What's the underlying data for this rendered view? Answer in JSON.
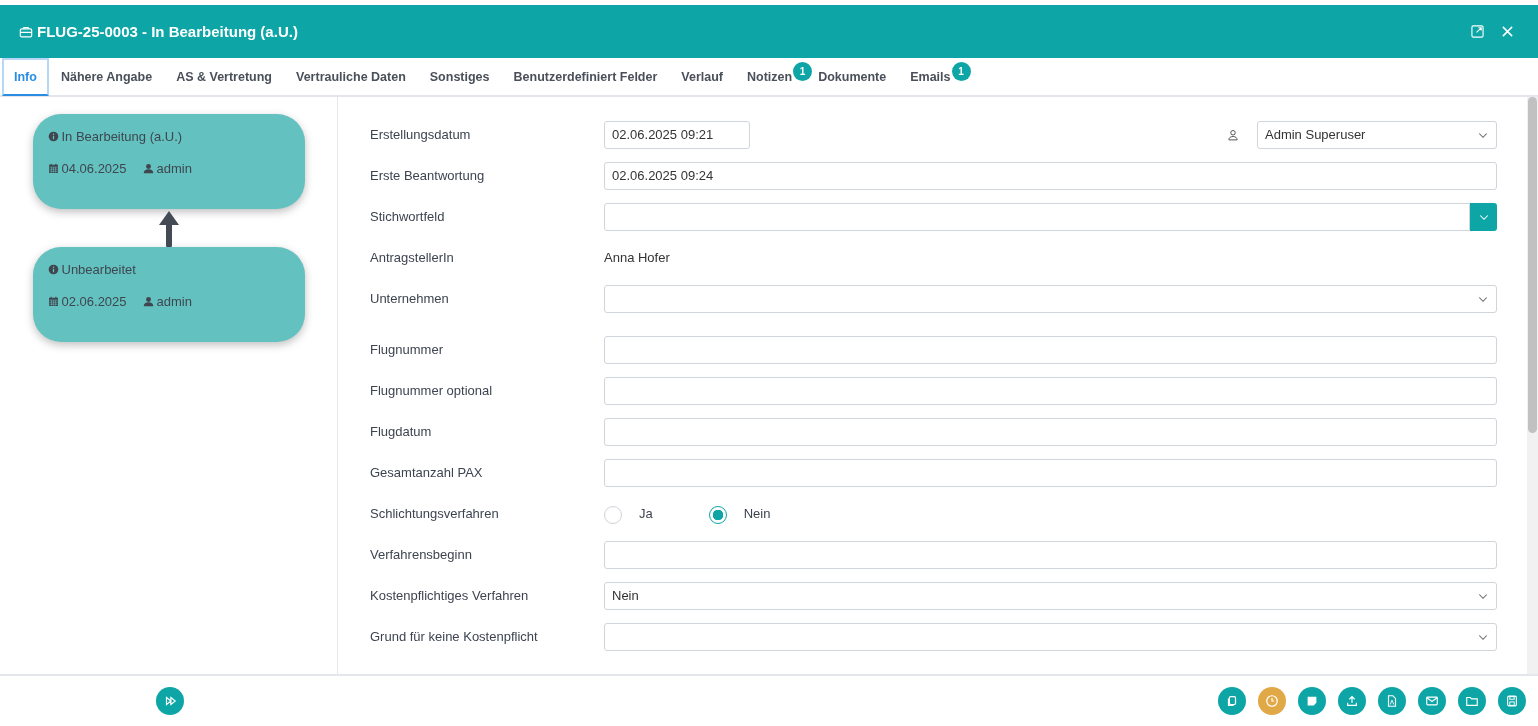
{
  "window": {
    "title": "FLUG-25-0003 - In Bearbeitung (a.U.)"
  },
  "tabs": [
    {
      "label": "Info",
      "selected": true
    },
    {
      "label": "Nähere Angabe",
      "selected": false
    },
    {
      "label": "AS & Vertretung",
      "selected": false
    },
    {
      "label": "Vertrauliche Daten",
      "selected": false
    },
    {
      "label": "Sonstiges",
      "selected": false
    },
    {
      "label": "Benutzerdefiniert Felder",
      "selected": false
    },
    {
      "label": "Verlauf",
      "selected": false
    },
    {
      "label": "Notizen",
      "selected": false,
      "badge": "1"
    },
    {
      "label": "Dokumente",
      "selected": false
    },
    {
      "label": "Emails",
      "selected": false,
      "badge": "1"
    }
  ],
  "status_history": [
    {
      "status": "In Bearbeitung (a.U.)",
      "date": "04.06.2025",
      "user": "admin"
    },
    {
      "status": "Unbearbeitet",
      "date": "02.06.2025",
      "user": "admin"
    }
  ],
  "form": {
    "fields": [
      {
        "kind": "date",
        "label": "Erstellungsdatum",
        "value": "02.06.2025 09:21",
        "assignee": "Admin Superuser"
      },
      {
        "kind": "input",
        "label": "Erste Beantwortung",
        "value": "02.06.2025 09:24"
      },
      {
        "kind": "combo",
        "label": "Stichwortfeld"
      },
      {
        "kind": "static",
        "label": "AntragstellerIn",
        "value": "Anna Hofer"
      },
      {
        "kind": "select",
        "label": "Unternehmen"
      },
      {
        "kind": "spacer"
      },
      {
        "kind": "input",
        "label": "Flugnummer"
      },
      {
        "kind": "input",
        "label": "Flugnummer optional"
      },
      {
        "kind": "input",
        "label": "Flugdatum"
      },
      {
        "kind": "input",
        "label": "Gesamtanzahl PAX"
      },
      {
        "kind": "radio",
        "label": "Schlichtungsverfahren",
        "options": [
          {
            "label": "Ja",
            "selected": false
          },
          {
            "label": "Nein",
            "selected": true
          }
        ]
      },
      {
        "kind": "input",
        "label": "Verfahrensbeginn"
      },
      {
        "kind": "select",
        "label": "Kostenpflichtiges Verfahren",
        "value": "Nein"
      },
      {
        "kind": "select",
        "label": "Grund für keine Kostenpflicht"
      }
    ]
  },
  "footer": {
    "left_actions": [
      {
        "kind": "forward"
      }
    ],
    "actions": [
      {
        "kind": "copy",
        "color": "#0ea5a6"
      },
      {
        "kind": "clock",
        "color": "#e0a847"
      },
      {
        "kind": "note",
        "color": "#0ea5a6"
      },
      {
        "kind": "upload",
        "color": "#0ea5a6"
      },
      {
        "kind": "pdf",
        "color": "#0ea5a6"
      },
      {
        "kind": "mail",
        "color": "#0ea5a6"
      },
      {
        "kind": "folder",
        "color": "#0ea5a6"
      },
      {
        "kind": "save",
        "color": "#0ea5a6"
      }
    ]
  }
}
